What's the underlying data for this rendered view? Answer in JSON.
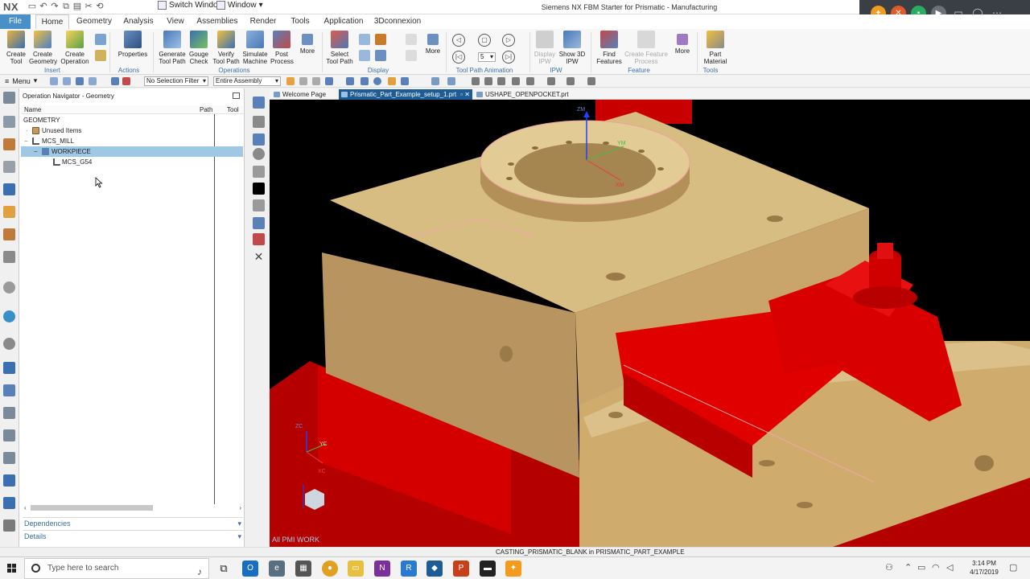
{
  "title_bar": {
    "logo": "NX",
    "switch_window": "Switch Window",
    "window": "Window",
    "app_title": "Siemens NX FBM Starter for Prismatic - Manufacturing"
  },
  "menu_tabs": [
    "File",
    "Home",
    "Geometry",
    "Analysis",
    "View",
    "Assemblies",
    "Render",
    "Tools",
    "Application",
    "3Dconnexion"
  ],
  "ribbon": {
    "insert": {
      "group": "Insert",
      "create_tool": "Create Tool",
      "create_geometry": "Create Geometry",
      "create_operation": "Create Operation"
    },
    "actions": {
      "group": "Actions",
      "properties": "Properties"
    },
    "operations": {
      "group": "Operations",
      "generate_tool_path": "Generate Tool Path",
      "gouge_check": "Gouge Check",
      "verify_tool_path": "Verify Tool Path",
      "simulate_machine": "Simulate Machine",
      "post_process": "Post Process",
      "more": "More"
    },
    "display": {
      "group": "Display",
      "select_tool_path": "Select Tool Path",
      "more": "More"
    },
    "animation": {
      "group": "Tool Path Animation",
      "speed": "5"
    },
    "ipw": {
      "group": "IPW",
      "display_ipw": "Display IPW",
      "show_3d_ipw": "Show 3D IPW"
    },
    "feature": {
      "group": "Feature",
      "find_features": "Find Features",
      "create_feature_process": "Create Feature Process",
      "more": "More"
    },
    "tools": {
      "group": "Tools",
      "part_material": "Part Material"
    }
  },
  "selection_bar": {
    "menu": "Menu",
    "filter": "No Selection Filter",
    "scope": "Entire Assembly"
  },
  "navigator": {
    "title": "Operation Navigator - Geometry",
    "columns": [
      "Name",
      "Path",
      "Tool"
    ],
    "rows": [
      {
        "label": "GEOMETRY",
        "level": 0
      },
      {
        "label": "Unused Items",
        "level": 1
      },
      {
        "label": "MCS_MILL",
        "level": 1
      },
      {
        "label": "WORKPIECE",
        "level": 2
      },
      {
        "label": "MCS_G54",
        "level": 3
      }
    ],
    "panels": [
      "Dependencies",
      "Details"
    ]
  },
  "doc_tabs": [
    "Welcome Page",
    "Prismatic_Part_Example_setup_1.prt",
    "USHAPE_OPENPOCKET.prt"
  ],
  "viewport": {
    "label": "All PMI WORK",
    "triad": {
      "z": "ZC",
      "y": "YC",
      "x": "XC"
    },
    "wcs": {
      "z": "ZM",
      "y": "YM",
      "x": "XM"
    }
  },
  "status_bar": {
    "message": "CASTING_PRISMATIC_BLANK in PRISMATIC_PART_EXAMPLE"
  },
  "taskbar": {
    "search_placeholder": "Type here to search",
    "time": "3:14 PM",
    "date": "4/17/2019"
  },
  "colors": {
    "accent": "#1e5c95",
    "file_tab": "#4a90c8",
    "part_tan": "#d8b577",
    "fixture_red": "#d40000"
  }
}
